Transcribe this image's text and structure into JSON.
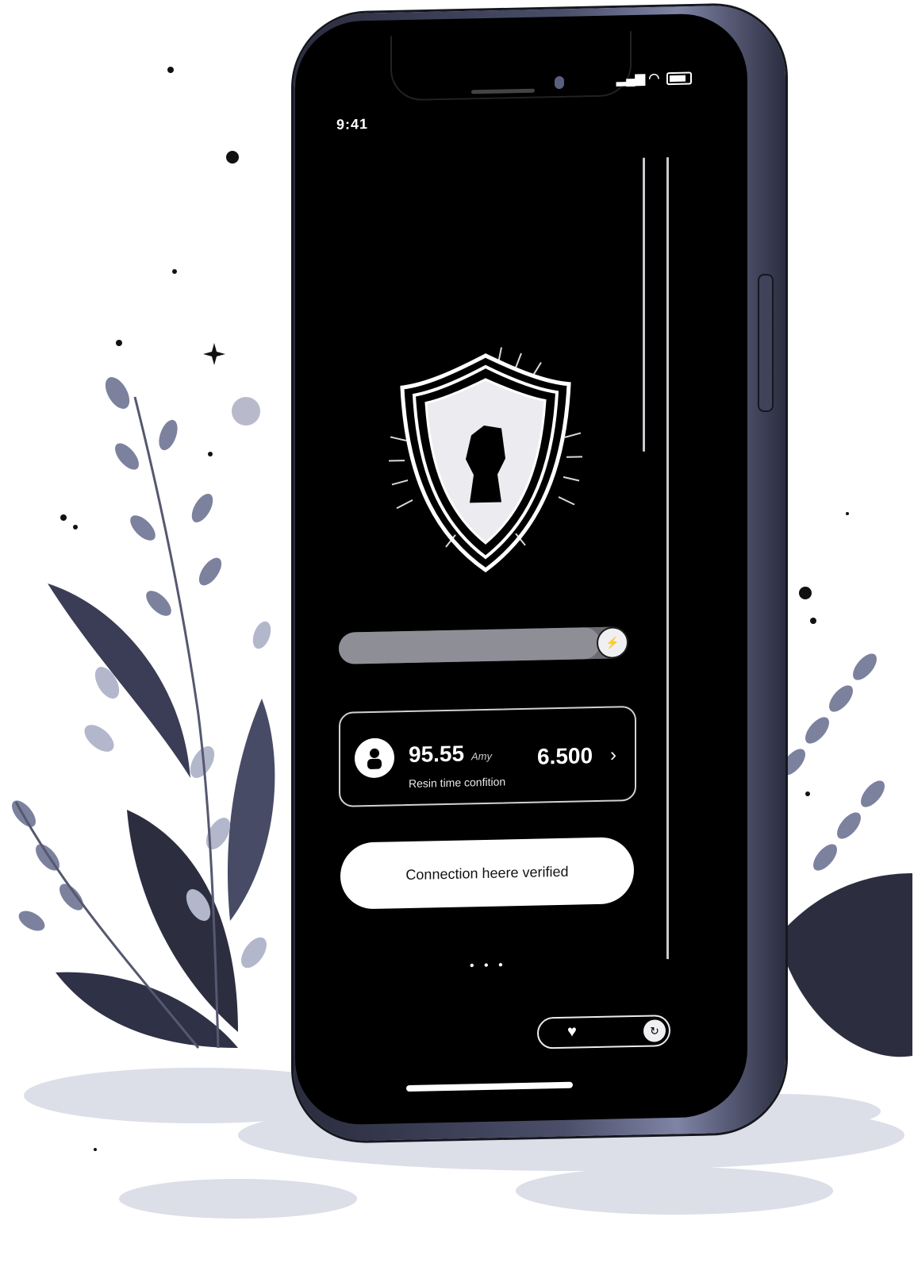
{
  "status_bar": {
    "time": "9:41",
    "signal_icon": "cell-signal-icon",
    "wifi_icon": "wifi-icon",
    "battery_icon": "battery-icon"
  },
  "security": {
    "icon": "shield-lock-icon"
  },
  "progress": {
    "value": 0.9,
    "knob_icon": "bolt-icon",
    "knob_glyph": "⚡"
  },
  "info_card": {
    "avatar_icon": "person-icon",
    "value": "95.55",
    "unit": "Amy",
    "subtitle": "Resin time confition",
    "amount": "6.500",
    "chevron": "›"
  },
  "verify_button": {
    "label": "Connection heere verified"
  },
  "pagination": {
    "dots": "• • •",
    "active_index": 0
  },
  "bottom_toggle": {
    "heart_icon": "heart-icon",
    "heart_glyph": "♥",
    "end_icon": "refresh-icon",
    "end_glyph": "↻"
  },
  "colors": {
    "screen": "#000000",
    "frame": "#4a4e68",
    "foliage_dark": "#3a3d55",
    "foliage_light": "#9aa0b8",
    "ground": "#d8dae6"
  }
}
